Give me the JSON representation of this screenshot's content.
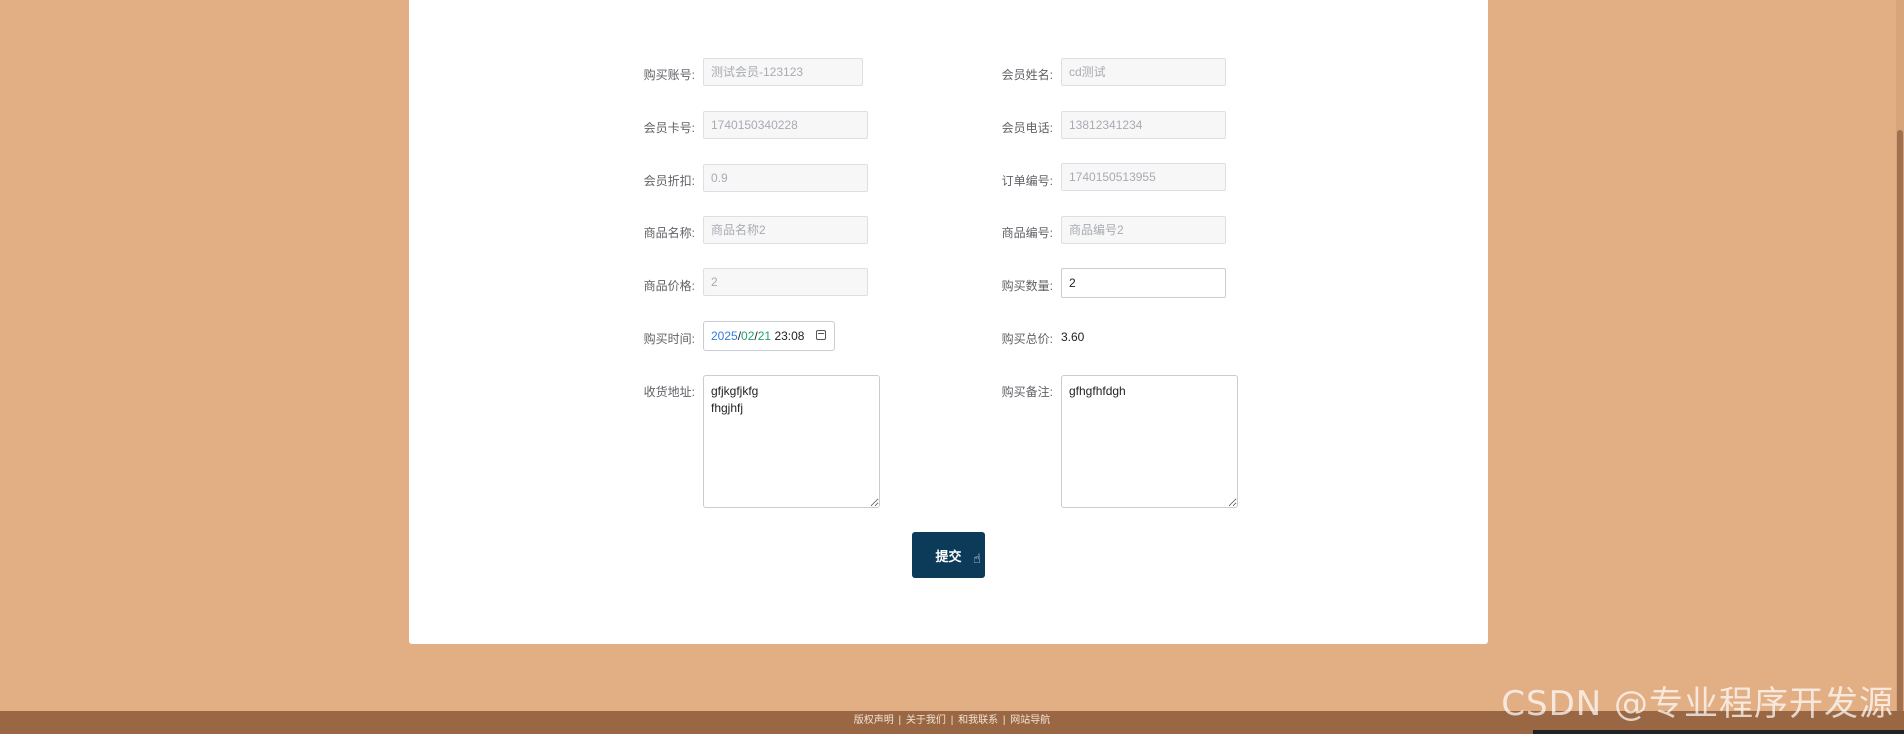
{
  "form": {
    "account": {
      "label": "购买账号:",
      "value": "测试会员-123123"
    },
    "member_name": {
      "label": "会员姓名:",
      "value": "cd测试"
    },
    "card_no": {
      "label": "会员卡号:",
      "value": "1740150340228"
    },
    "phone": {
      "label": "会员电话:",
      "value": "13812341234"
    },
    "discount": {
      "label": "会员折扣:",
      "value": "0.9"
    },
    "order_no": {
      "label": "订单编号:",
      "value": "1740150513955"
    },
    "goods_name": {
      "label": "商品名称:",
      "value": "商品名称2"
    },
    "goods_no": {
      "label": "商品编号:",
      "value": "商品编号2"
    },
    "price": {
      "label": "商品价格:",
      "value": "2"
    },
    "quantity": {
      "label": "购买数量:",
      "value": "2"
    },
    "buy_time": {
      "label": "购买时间:",
      "year": "2025",
      "month": "02",
      "day": "21",
      "time": "23:08",
      "sep": "/"
    },
    "total": {
      "label": "购买总价:",
      "value": "3.60"
    },
    "address": {
      "label": "收货地址:",
      "value": "gfjkgfjkfg\nfhgjhfj"
    },
    "remark": {
      "label": "购买备注:",
      "value": "gfhgfhfdgh"
    }
  },
  "submit_label": "提交",
  "footer": {
    "links": [
      "版权声明",
      "关于我们",
      "和我联系",
      "网站导航"
    ],
    "separator": "|"
  },
  "watermark": "CSDN @专业程序开发源"
}
